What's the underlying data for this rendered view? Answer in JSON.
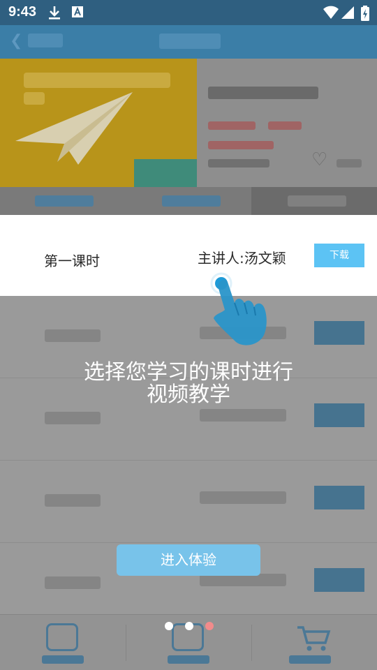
{
  "status_bar": {
    "time": "9:43",
    "icons": [
      "download-icon",
      "a-notification-icon",
      "wifi-icon",
      "cell-signal-icon",
      "battery-charging-icon"
    ]
  },
  "highlight_row": {
    "lesson": "第一课时",
    "speaker": "主讲人:汤文颖",
    "download_label": "下载"
  },
  "guide": {
    "line1": "选择您学习的课时进行",
    "line2": "视频教学"
  },
  "cta_label": "进入体验",
  "pager": {
    "count": 3,
    "active_index": 2,
    "active_color": "#f28b8b",
    "inactive_color": "#ffffff"
  },
  "colors": {
    "accent": "#5cc3f4",
    "cta": "#78c3ea",
    "header": "#3b7ea7"
  }
}
